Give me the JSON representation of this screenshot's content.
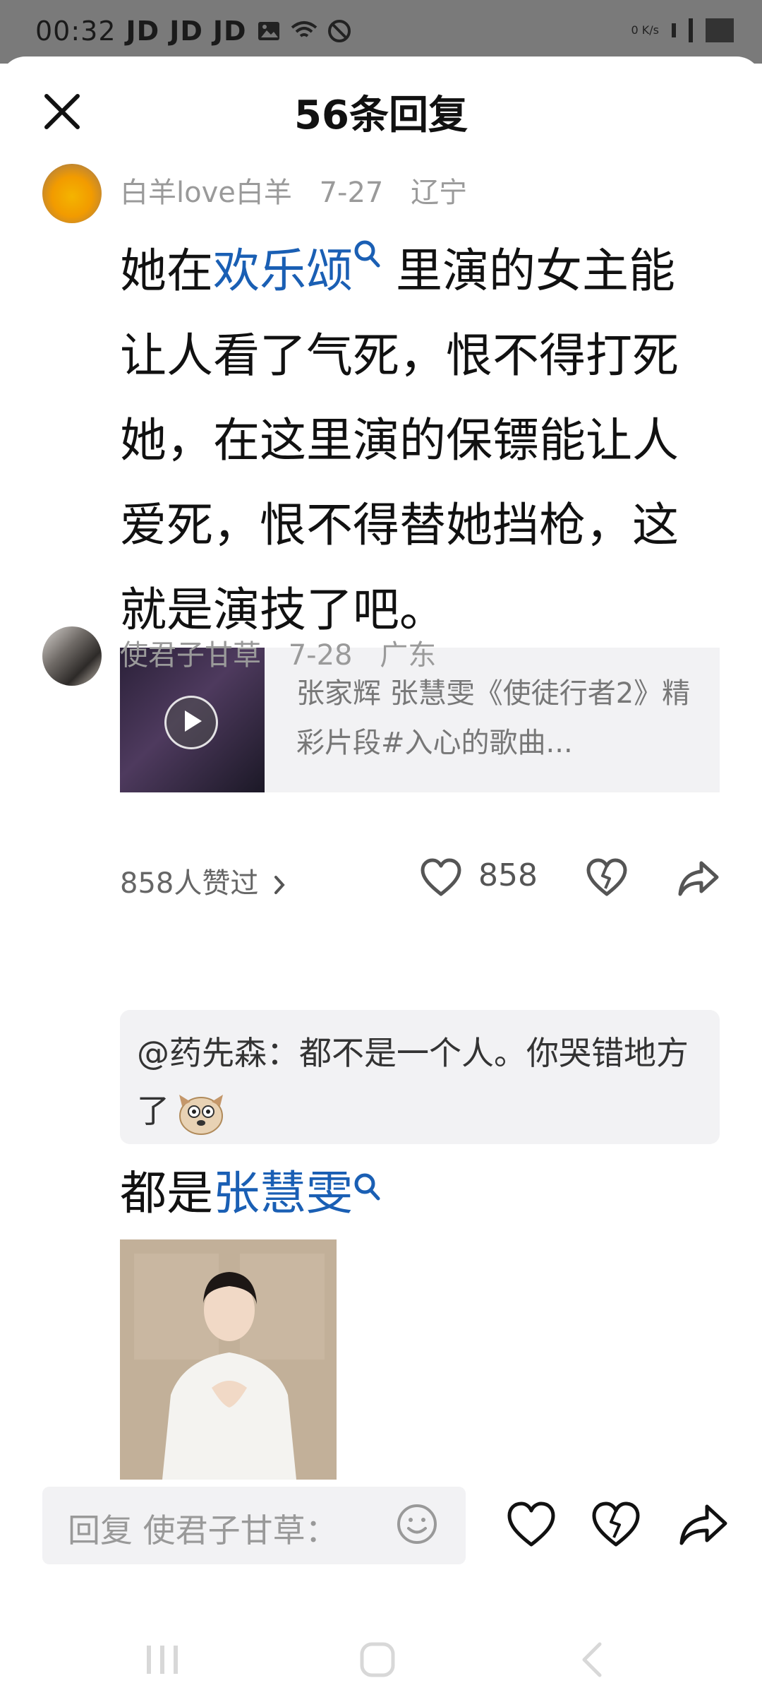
{
  "status_bar": {
    "time": "00:32",
    "notifications": [
      "JD",
      "JD",
      "JD"
    ],
    "net_speed": "0\nK/s"
  },
  "header": {
    "title": "56条回复",
    "close_icon": "close-icon"
  },
  "comments": [
    {
      "username": "白羊love白羊",
      "date": "7-27",
      "location": "辽宁",
      "text_before": "她在",
      "link_text": "欢乐颂",
      "text_after": " 里演的女主能让人看了气死，恨不得打死她，在这里演的保镖能让人爱死，恨不得替她挡枪，这就是演技了吧。",
      "video_title": "张家辉  张慧雯《使徒行者2》精彩片段#入心的歌曲...",
      "liked_by": "858人赞过",
      "like_count": "858"
    },
    {
      "username": "使君子甘草",
      "date": "7-28",
      "location": "广东",
      "quote": "@药先森：都不是一个人。你哭错地方了",
      "text_before": "都是",
      "link_text": "张慧雯"
    }
  ],
  "reply_bar": {
    "placeholder": "回复 使君子甘草："
  },
  "colors": {
    "link": "#1a5fb4",
    "meta": "#9a9a9a",
    "card_bg": "#f2f2f4"
  }
}
